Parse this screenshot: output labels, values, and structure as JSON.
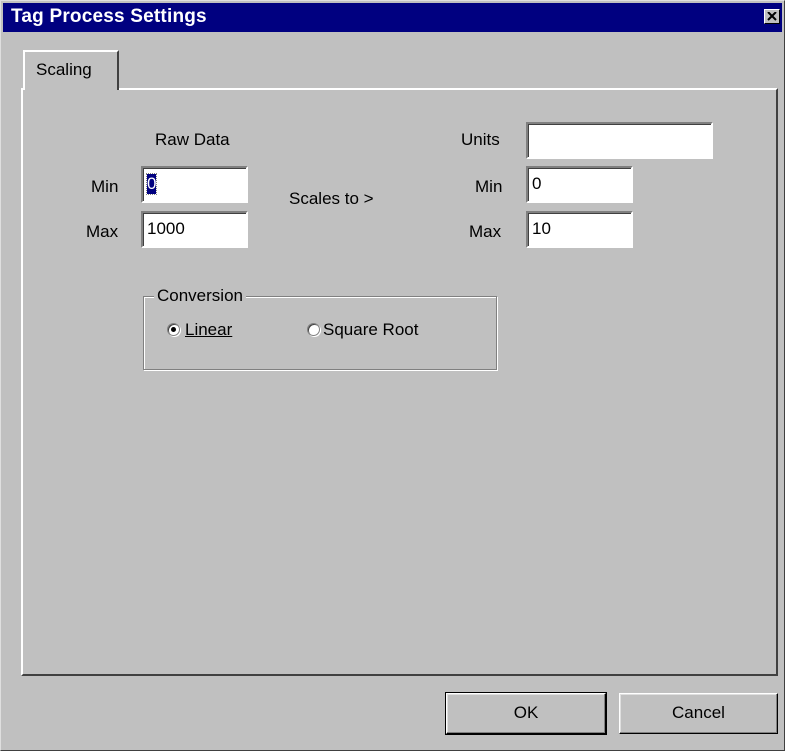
{
  "window": {
    "title": "Tag Process Settings"
  },
  "tabs": [
    {
      "label": "Scaling"
    }
  ],
  "raw": {
    "heading": "Raw Data",
    "min_label": "Min",
    "min_value": "0",
    "max_label": "Max",
    "max_value": "1000"
  },
  "scales_to_label": "Scales to >",
  "scaled": {
    "units_label": "Units",
    "units_value": "",
    "min_label": "Min",
    "min_value": "0",
    "max_label": "Max",
    "max_value": "10"
  },
  "conversion": {
    "title": "Conversion",
    "options": [
      {
        "label": "Linear",
        "selected": true
      },
      {
        "label": "Square Root",
        "selected": false
      }
    ]
  },
  "buttons": {
    "ok": "OK",
    "cancel": "Cancel"
  },
  "colors": {
    "titlebar": "#000080",
    "face": "#c0c0c0"
  }
}
